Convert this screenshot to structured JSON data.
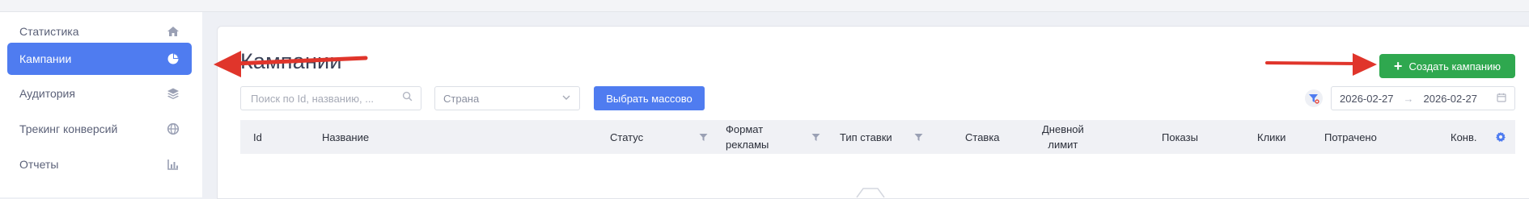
{
  "sidebar": {
    "items": [
      {
        "label": "Статистика",
        "icon": "home-icon",
        "active": false
      },
      {
        "label": "Кампании",
        "icon": "pie-chart-icon",
        "active": true
      },
      {
        "label": "Аудитория",
        "icon": "layers-icon",
        "active": false
      },
      {
        "label": "Трекинг конверсий",
        "icon": "globe-icon",
        "active": false
      },
      {
        "label": "Отчеты",
        "icon": "bar-chart-icon",
        "active": false
      }
    ]
  },
  "main": {
    "title": "Кампании",
    "create_button": "Создать кампанию",
    "search": {
      "placeholder": "Поиск по Id, названию, ...",
      "value": ""
    },
    "country_select": {
      "placeholder": "Страна"
    },
    "bulk_select_button": "Выбрать массово",
    "date_range": {
      "start": "2026-02-27",
      "end": "2026-02-27",
      "separator": "→"
    },
    "table": {
      "columns": [
        {
          "label": "Id",
          "filter": false
        },
        {
          "label": "Название",
          "filter": false
        },
        {
          "label": "Статус",
          "filter": true
        },
        {
          "label": "Формат рекламы",
          "line1": "Формат",
          "line2": "рекламы",
          "filter": true
        },
        {
          "label": "Тип ставки",
          "filter": true
        },
        {
          "label": "Ставка",
          "filter": false
        },
        {
          "label": "Дневной лимит",
          "line1": "Дневной",
          "line2": "лимит",
          "filter": false
        },
        {
          "label": "Показы",
          "filter": false
        },
        {
          "label": "Клики",
          "filter": false
        },
        {
          "label": "Потрачено",
          "filter": false
        },
        {
          "label": "Конв.",
          "filter": false
        }
      ],
      "rows": []
    }
  },
  "colors": {
    "primary": "#4f7cf0",
    "success": "#2fa84f",
    "annotation_arrow": "#e0352b"
  }
}
